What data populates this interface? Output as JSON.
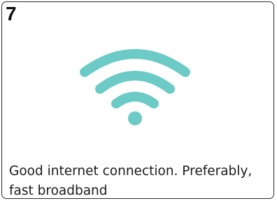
{
  "card": {
    "step_number": "7",
    "icon": "wifi-icon",
    "icon_color": "#6ccbc6",
    "caption": "Good internet connection. Preferably, fast broadband"
  }
}
